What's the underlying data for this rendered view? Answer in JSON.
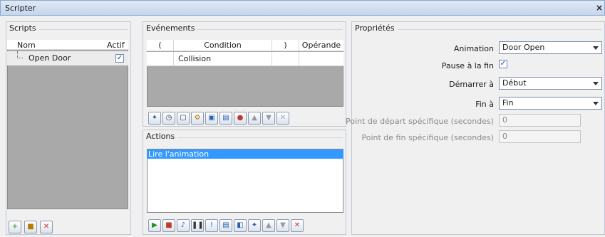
{
  "window": {
    "title": "Scripter",
    "close": "×"
  },
  "scripts": {
    "title": "Scripts",
    "columns": [
      "Nom",
      "Actif"
    ],
    "rows": [
      {
        "name": "Open Door",
        "active": true
      }
    ]
  },
  "events": {
    "title": "Evénements",
    "columns": [
      "(",
      "Condition",
      ")",
      "Opérande"
    ],
    "rows": [
      {
        "open": "",
        "condition": "Collision",
        "close": "",
        "operand": ""
      }
    ]
  },
  "actions": {
    "title": "Actions",
    "items": [
      "Lire l'animation"
    ]
  },
  "properties": {
    "title": "Propriétés",
    "animation_label": "Animation",
    "animation_value": "Door Open",
    "pause_label": "Pause à la fin",
    "pause_checked": true,
    "start_label": "Démarrer à",
    "start_value": "Début",
    "end_label": "Fin à",
    "end_value": "Fin",
    "start_point_label": "Point de départ spécifique (secondes)",
    "start_point_value": "0",
    "end_point_label": "Point de fin spécifique (secondes)",
    "end_point_value": "0"
  },
  "icons": {
    "check": "✓"
  }
}
